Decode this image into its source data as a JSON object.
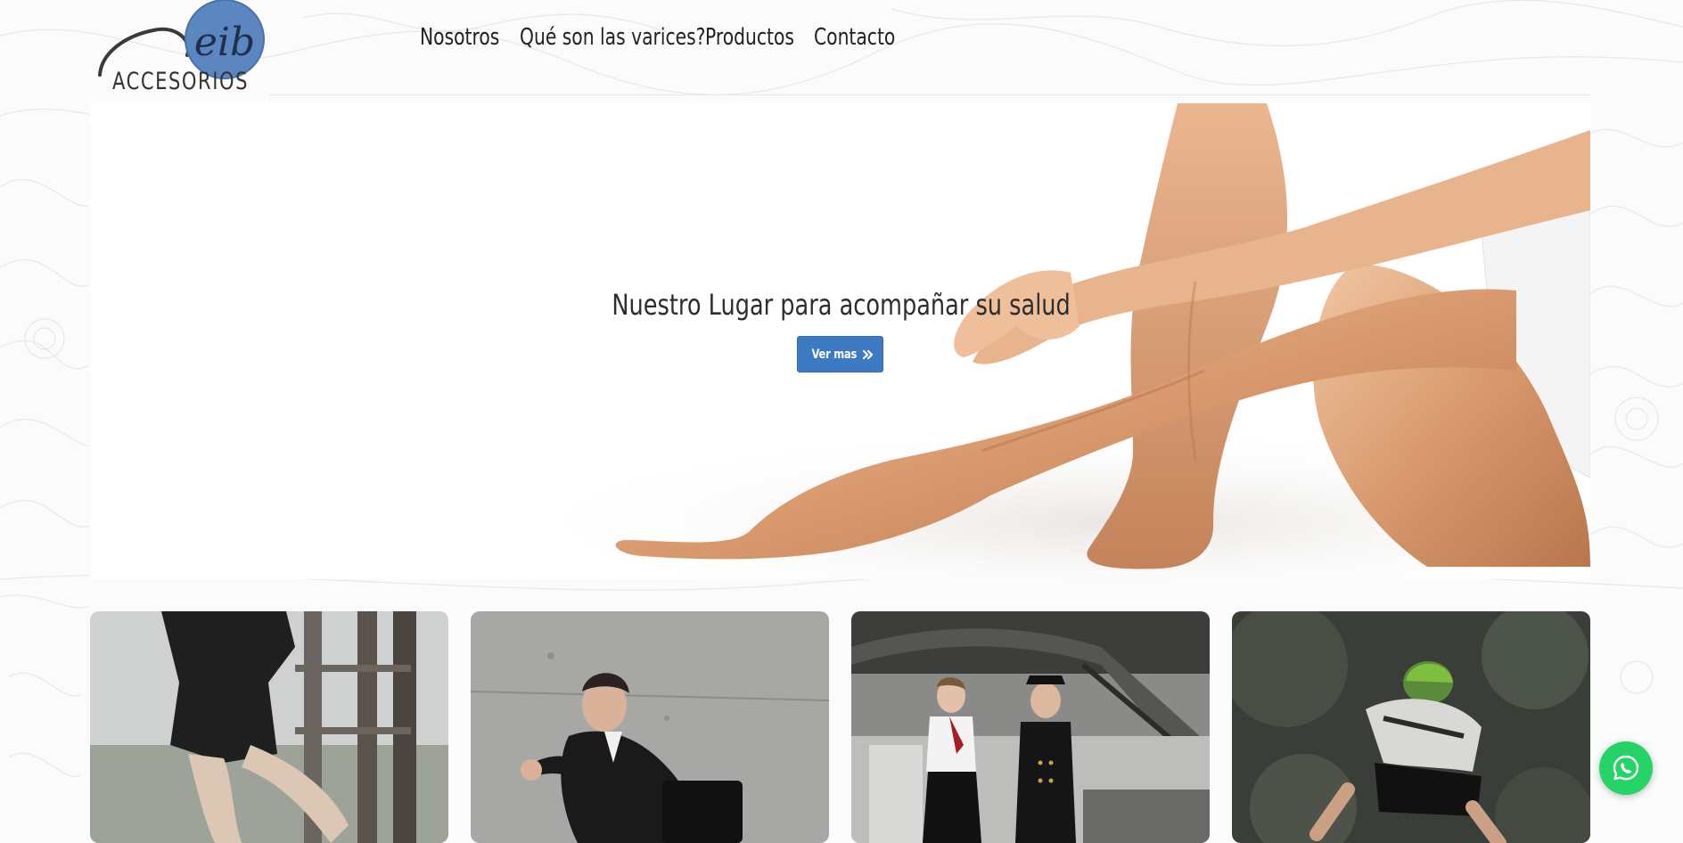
{
  "brand": {
    "logo_mark": "eib",
    "logo_text": "ACCESORIOS"
  },
  "nav": {
    "items": [
      "Nosotros",
      "Qué son las varices?",
      "Productos",
      "Contacto"
    ]
  },
  "hero": {
    "title": "Nuestro Lugar para acompañar su salud",
    "button_label": "Ver mas",
    "button_icon": "double-chevron-right-icon"
  },
  "cards": [
    {
      "image": "woman-climbing-photo"
    },
    {
      "image": "businessman-running-photo"
    },
    {
      "image": "flight-crew-photo"
    },
    {
      "image": "cyclist-photo"
    }
  ],
  "floating": {
    "icon": "whatsapp-icon"
  },
  "colors": {
    "accent": "#3d7ac4",
    "logo_blue": "#5b86c0",
    "whatsapp": "#25d366",
    "text": "#222222"
  }
}
